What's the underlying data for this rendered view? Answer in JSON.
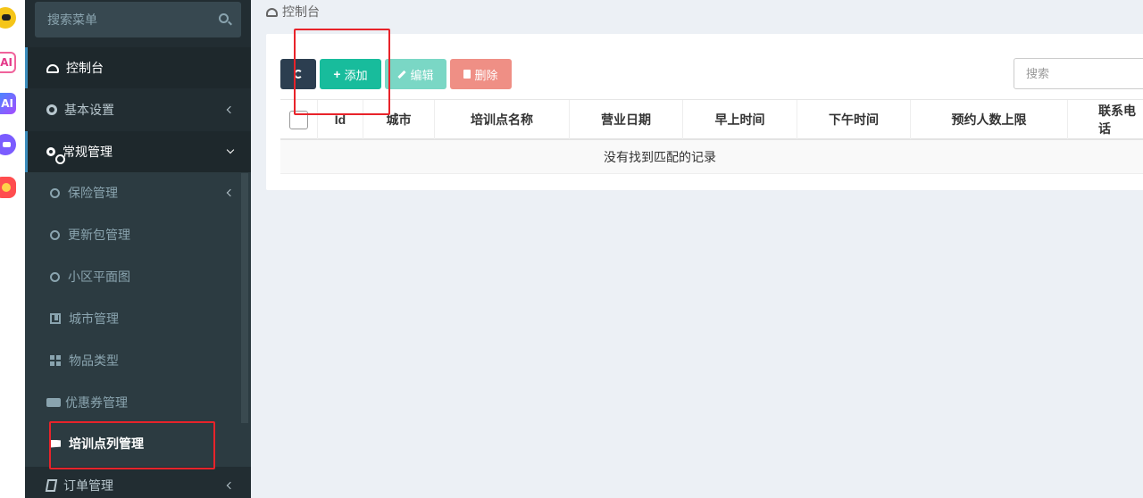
{
  "sidebar": {
    "search_placeholder": "搜索菜单",
    "items": [
      {
        "label": "控制台"
      },
      {
        "label": "基本设置"
      },
      {
        "label": "常规管理"
      }
    ],
    "subitems": [
      {
        "label": "保险管理"
      },
      {
        "label": "更新包管理"
      },
      {
        "label": "小区平面图"
      },
      {
        "label": "城市管理"
      },
      {
        "label": "物品类型"
      },
      {
        "label": "优惠券管理"
      },
      {
        "label": "培训点列管理"
      }
    ],
    "bottom_item": {
      "label": "订单管理"
    }
  },
  "breadcrumb": {
    "label": "控制台"
  },
  "toolbar": {
    "add_label": "添加",
    "edit_label": "编辑",
    "delete_label": "删除",
    "search_placeholder": "搜索"
  },
  "table": {
    "columns": [
      "Id",
      "城市",
      "培训点名称",
      "营业日期",
      "早上时间",
      "下午时间",
      "预约人数上限",
      "联系电话"
    ],
    "empty_text": "没有找到匹配的记录"
  },
  "colors": {
    "sidebar_bg": "#222d32",
    "add_button": "#18bc9c",
    "delete_button": "#ef8f85",
    "highlight_box": "#e8232a"
  }
}
